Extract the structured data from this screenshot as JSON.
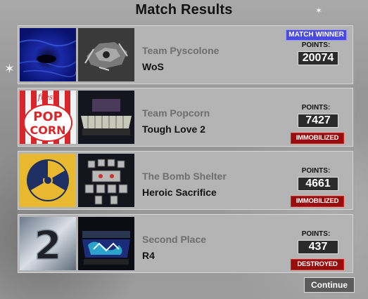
{
  "screen": {
    "title": "Match Results"
  },
  "results": [
    {
      "team": "Team Pyscolone",
      "robot": "WoS",
      "points_label": "POINTS:",
      "points": "20074",
      "badge": "MATCH WINNER",
      "status": ""
    },
    {
      "team": "Team Popcorn",
      "robot": "Tough Love 2",
      "points_label": "POINTS:",
      "points": "7427",
      "badge": "",
      "status": "IMMOBILIZED"
    },
    {
      "team": "The Bomb Shelter",
      "robot": "Heroic Sacrifice",
      "points_label": "POINTS:",
      "points": "4661",
      "badge": "",
      "status": "IMMOBILIZED"
    },
    {
      "team": "Second Place",
      "robot": "R4",
      "points_label": "POINTS:",
      "points": "437",
      "badge": "",
      "status": "DESTROYED"
    }
  ],
  "logos": {
    "popcorn_top": "fresh",
    "popcorn_mid": "POP",
    "popcorn_bottom": "CORN",
    "second_place": "2"
  },
  "colors": {
    "winner_badge": "#4a4ae0",
    "status_badge": "#9a0c0c",
    "points_box": "#2b2b2b"
  },
  "buttons": {
    "continue": "Continue"
  }
}
